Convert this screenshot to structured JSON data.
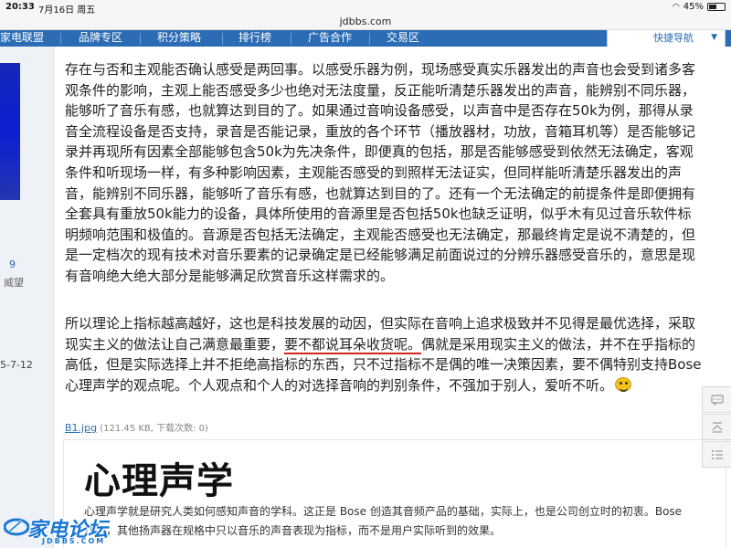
{
  "status_bar": {
    "time": "20:33",
    "date": "7月16日 周五",
    "battery": "45%",
    "battery_level": 0.45
  },
  "url": "jdbbs.com",
  "nav": {
    "items": [
      "家电联盟",
      "品牌专区",
      "积分策略",
      "排行榜",
      "广告合作",
      "交易区"
    ],
    "quick_nav": "快捷导航"
  },
  "author": {
    "stat_value": "9",
    "stat_label": "威望",
    "reg_date": "5-7-12"
  },
  "post": {
    "para1": "存在与否和主观能否确认感受是两回事。以感受乐器为例，现场感受真实乐器发出的声音也会受到诸多客观条件的影响，主观上能否感受多少也绝对无法度量，反正能听清楚乐器发出的声音，能辨别不同乐器，能够听了音乐有感，也就算达到目的了。如果通过音响设备感受，以声音中是否存在50k为例，那得从录音全流程设备是否支持，录音是否能记录，重放的各个环节（播放器材，功放，音箱耳机等）是否能够记录并再现所有因素全部能够包含50k为先决条件，即便真的包括，那是否能够感受到依然无法确定，客观条件和听现场一样，有多种影响因素，主观能否感受的到照样无法证实，但同样能听清楚乐器发出的声音，能辨别不同乐器，能够听了音乐有感，也就算达到目的了。还有一个无法确定的前提条件是即便拥有全套具有重放50k能力的设备，具体所使用的音源里是否包括50k也缺乏证明，似乎木有见过音乐软件标明频响范围和极值的。音源是否包括无法确定，主观能否感受也无法确定，那最终肯定是说不清楚的，但是一定档次的现有技术对音乐要素的记录确定是已经能够满足前面说过的分辨乐器感受音乐的，意思是现有音响绝大绝大部分是能够满足欣赏音乐这样需求的。",
    "para2_a": "所以理论上指标越高越好，这也是科技发展的动因，但实际在音响上追求极致并不见得是最优选择，采取现实主义的做法让自己满意最重要，",
    "para2_b": "要不都说耳朵收货呢。",
    "para2_c": "偶就是采用现实主义的做法，并不在乎指标的高低，但是实际选择上并不拒绝高指标的东西，只不过指标不是偶的唯一决策因素，要不偶特别支持Bose心理声学的观点呢。个人观点和个人的对选择音响的判别条件，不强加于别人，爱听不听。"
  },
  "attachment": {
    "name": "B1.jpg",
    "info": "(121.45 KB, 下载次数: 0)"
  },
  "image_card": {
    "heading": "心理声学",
    "line1": "心理声学就是研究人类如何感知声音的学科。这正是 Bose 创造其音频产品的基础，实际上，也是公司创立时的初衷。Bose",
    "line2": "认为，其他扬声器在规格中只以音乐的声音表现为指标，而不是用户实际听到的效果。"
  },
  "logo": {
    "text": "家电论坛",
    "sub": "JDBBS.COM"
  },
  "tools": [
    "comment-icon",
    "back-to-top-icon",
    "menu-icon"
  ]
}
